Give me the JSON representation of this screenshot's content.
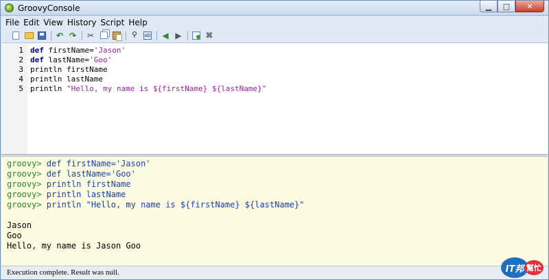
{
  "window": {
    "title": "GroovyConsole",
    "minimize": "▁",
    "maximize": "□",
    "close": "✕"
  },
  "menu": [
    {
      "label": "File"
    },
    {
      "label": "Edit"
    },
    {
      "label": "View"
    },
    {
      "label": "History"
    },
    {
      "label": "Script"
    },
    {
      "label": "Help"
    }
  ],
  "toolbar": {
    "icons": [
      "new-file-icon",
      "open-file-icon",
      "save-icon",
      "undo-icon",
      "redo-icon",
      "cut-icon",
      "copy-icon",
      "paste-icon",
      "find-icon",
      "replace-icon",
      "history-back-icon",
      "history-forward-icon",
      "run-script-icon",
      "interrupt-icon"
    ],
    "glyphs": {
      "undo": "↶",
      "redo": "↷",
      "cut": "✂",
      "find": "⚲",
      "replace": "ab",
      "back": "◀",
      "forward": "▶",
      "stop": "✖"
    }
  },
  "editor": {
    "lines": [
      {
        "n": "1",
        "kw": "def",
        "rest": " firstName=",
        "str": "'Jason'"
      },
      {
        "n": "2",
        "kw": "def",
        "rest": " lastName=",
        "str": "'Goo'"
      },
      {
        "n": "3",
        "kw": "",
        "rest": "println firstName",
        "str": ""
      },
      {
        "n": "4",
        "kw": "",
        "rest": "println lastName",
        "str": ""
      },
      {
        "n": "5",
        "kw": "",
        "rest": "println ",
        "str": "\"Hello, my name is ${firstName} ${lastName}\""
      }
    ]
  },
  "output": {
    "prompt": "groovy>",
    "echo": [
      " def firstName='Jason'",
      " def lastName='Goo'",
      " println firstName",
      " println lastName",
      " println \"Hello, my name is ${firstName} ${lastName}\""
    ],
    "results": [
      "Jason",
      "Goo",
      "Hello, my name is Jason Goo"
    ]
  },
  "status": {
    "text": "Execution complete. Result was null."
  },
  "watermark": {
    "left": "IT邦",
    "right": "幫忙"
  }
}
